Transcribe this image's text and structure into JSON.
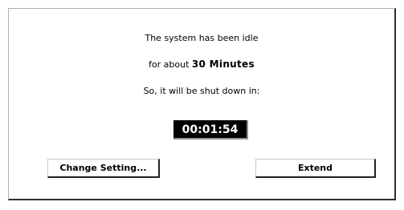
{
  "dialog": {
    "line1": "The system has been idle",
    "line2_prefix": "for about",
    "line2_value": "30 Minutes",
    "line3": "So, it will be shut down in:",
    "countdown": "00:01:54"
  },
  "buttons": {
    "change_setting": "Change Setting...",
    "extend": "Extend"
  }
}
